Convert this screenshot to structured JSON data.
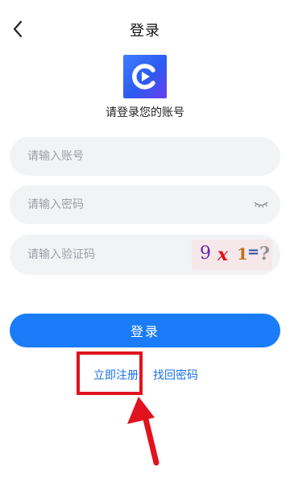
{
  "header": {
    "title": "登录",
    "back_icon": "chevron-left-icon"
  },
  "logo": {
    "icon": "play-logo-icon",
    "colors": [
      "#3f7cff",
      "#6a3df2"
    ]
  },
  "subtitle": "请登录您的账号",
  "form": {
    "account_placeholder": "请输入账号",
    "password_placeholder": "请输入密码",
    "captcha_placeholder": "请输入验证码",
    "captcha_image_text": [
      "9",
      "x",
      "1",
      "=",
      "?"
    ],
    "eye_icon": "eye-closed-icon"
  },
  "login_button": "登录",
  "links": {
    "register": "立即注册",
    "forgot": "找回密码"
  },
  "colors": {
    "accent": "#1a7cf8",
    "highlight": "#e0131e",
    "field_bg": "#f2f3f5"
  }
}
